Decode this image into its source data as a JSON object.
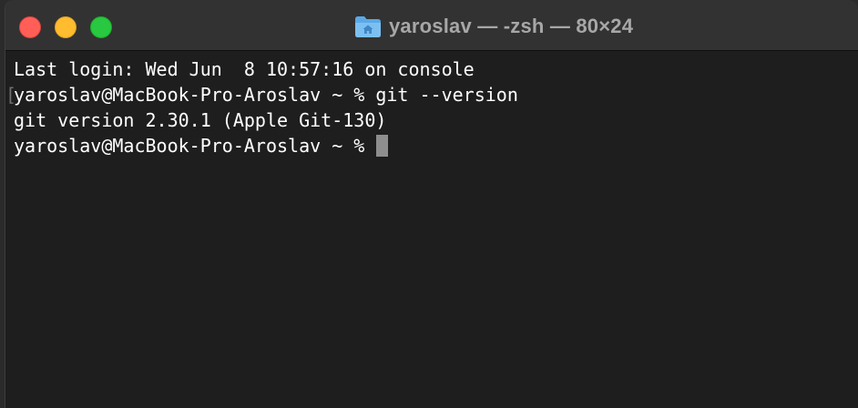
{
  "window": {
    "title": "yaroslav — -zsh — 80×24",
    "title_icon": "home-folder-icon"
  },
  "traffic_lights": {
    "close_color": "#ff5f57",
    "minimize_color": "#febc2e",
    "maximize_color": "#28c840"
  },
  "terminal": {
    "lines": [
      "Last login: Wed Jun  8 10:57:16 on console",
      "yaroslav@MacBook-Pro-Aroslav ~ % git --version",
      "git version 2.30.1 (Apple Git-130)",
      "yaroslav@MacBook-Pro-Aroslav ~ % "
    ],
    "mark_glyph": "[",
    "background": "#1e1e1e",
    "foreground": "#ffffff"
  }
}
